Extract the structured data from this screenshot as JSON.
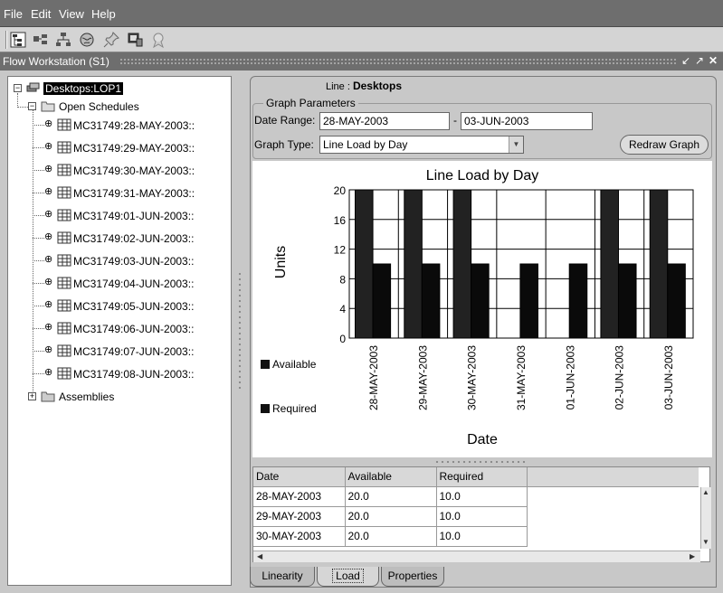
{
  "menubar": {
    "items": [
      "File",
      "Edit",
      "View",
      "Help"
    ]
  },
  "window": {
    "title": "Flow Workstation  (S1)"
  },
  "tree": {
    "root": "Desktops:LOP1",
    "open_schedules": "Open Schedules",
    "schedules": [
      "MC31749:28-MAY-2003::",
      "MC31749:29-MAY-2003::",
      "MC31749:30-MAY-2003::",
      "MC31749:31-MAY-2003::",
      "MC31749:01-JUN-2003::",
      "MC31749:02-JUN-2003::",
      "MC31749:03-JUN-2003::",
      "MC31749:04-JUN-2003::",
      "MC31749:05-JUN-2003::",
      "MC31749:06-JUN-2003::",
      "MC31749:07-JUN-2003::",
      "MC31749:08-JUN-2003::"
    ],
    "assemblies": "Assemblies"
  },
  "line": {
    "label": "Line",
    "value": "Desktops"
  },
  "graph_params": {
    "title": "Graph Parameters",
    "date_range_label": "Date Range:",
    "date_from": "28-MAY-2003",
    "separator": "-",
    "date_to": "03-JUN-2003",
    "graph_type_label": "Graph Type:",
    "graph_type": "Line Load by Day",
    "redraw_button": "Redraw Graph"
  },
  "chart_data": {
    "type": "bar",
    "title": "Line Load by Day",
    "xlabel": "Date",
    "ylabel": "Units",
    "categories": [
      "28-MAY-2003",
      "29-MAY-2003",
      "30-MAY-2003",
      "31-MAY-2003",
      "01-JUN-2003",
      "02-JUN-2003",
      "03-JUN-2003"
    ],
    "series": [
      {
        "name": "Available",
        "values": [
          20,
          20,
          20,
          0,
          0,
          20,
          20
        ],
        "color": "#222222"
      },
      {
        "name": "Required",
        "values": [
          10,
          10,
          10,
          10,
          10,
          10,
          10
        ],
        "color": "#0a0a0a"
      }
    ],
    "yticks": [
      0,
      4,
      8,
      12,
      16,
      20
    ],
    "ylim": [
      0,
      20
    ],
    "grid": true,
    "legend_position": "left"
  },
  "table": {
    "columns": [
      "Date",
      "Available",
      "Required"
    ],
    "rows": [
      [
        "28-MAY-2003",
        "20.0",
        "10.0"
      ],
      [
        "29-MAY-2003",
        "20.0",
        "10.0"
      ],
      [
        "30-MAY-2003",
        "20.0",
        "10.0"
      ]
    ]
  },
  "tabs": [
    {
      "label": "Linearity",
      "active": false
    },
    {
      "label": "Load",
      "active": true
    },
    {
      "label": "Properties",
      "active": false
    }
  ]
}
